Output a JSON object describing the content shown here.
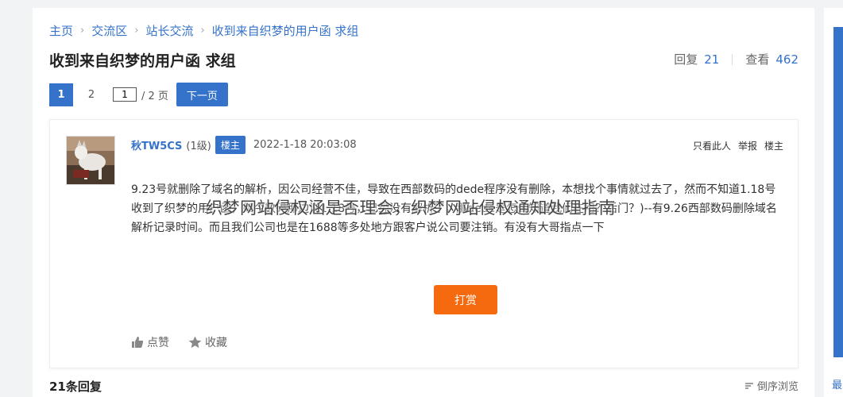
{
  "breadcrumb": {
    "items": [
      "主页",
      "交流区",
      "站长交流",
      "收到来自织梦的用户函 求组"
    ],
    "separator": "›"
  },
  "thread": {
    "title": "收到来自织梦的用户函 求组",
    "reply_label": "回复",
    "reply_count": "21",
    "view_label": "查看",
    "view_count": "462"
  },
  "pagination": {
    "pages": [
      "1",
      "2"
    ],
    "current_page": "1",
    "input_value": "1",
    "total": "/ 2 页",
    "next_label": "下一页"
  },
  "post": {
    "username": "秋TW5CS",
    "level": "(1级)",
    "badge": "楼主",
    "time": "2022-1-18 20:03:08",
    "actions": [
      "只看此人",
      "举报",
      "楼主"
    ],
    "content": "9.23号就删除了域名的解析，因公司经营不佳，导致在西部数码的dede程序没有删除，本想找个事情就过去了，然而不知道1.18号收到了织梦的用户函，如今数码那边说1.18号，已经没有解析了，那dede是怎么知道我们在用？后门？)--有9.26西部数码删除域名解析记录时间。而且我们公司也是在1688等多处地方跟客户说公司要注销。有没有大哥指点一下",
    "tip_label": "打赏",
    "like_label": "点赞",
    "favorite_label": "收藏"
  },
  "overlay_text": "织梦网站侵权涵是否理会，织梦网站侵权通知处理指南",
  "replies_header": "21条回复",
  "sort_label": "倒序浏览",
  "right_panel_text": "最",
  "colors": {
    "accent": "#3572c9",
    "tip": "#f56a0e",
    "background": "#f2f3f5"
  }
}
